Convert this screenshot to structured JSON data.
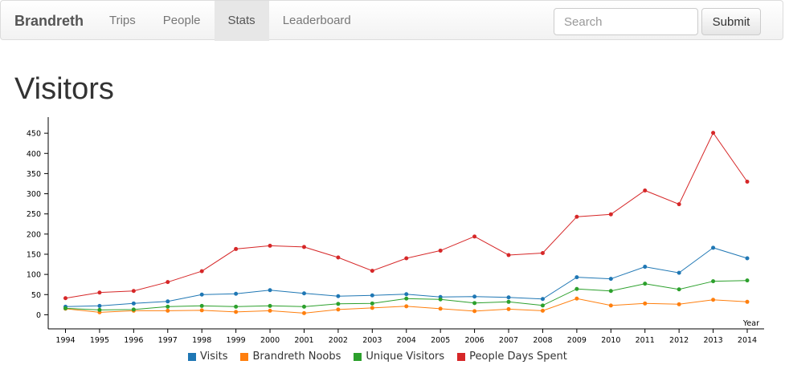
{
  "navbar": {
    "brand": "Brandreth",
    "items": [
      {
        "label": "Trips",
        "active": false
      },
      {
        "label": "People",
        "active": false
      },
      {
        "label": "Stats",
        "active": true
      },
      {
        "label": "Leaderboard",
        "active": false
      }
    ],
    "search_placeholder": "Search",
    "submit_label": "Submit"
  },
  "page": {
    "title": "Visitors"
  },
  "chart_data": {
    "type": "line",
    "title": "",
    "xlabel": "Year",
    "ylabel": "",
    "ylim": [
      -35,
      490
    ],
    "yticks": [
      0,
      50,
      100,
      150,
      200,
      250,
      300,
      350,
      400,
      450
    ],
    "categories": [
      "1994",
      "1995",
      "1996",
      "1997",
      "1998",
      "1999",
      "2000",
      "2001",
      "2002",
      "2003",
      "2004",
      "2005",
      "2006",
      "2007",
      "2008",
      "2009",
      "2010",
      "2011",
      "2012",
      "2013",
      "2014"
    ],
    "legend_position": "bottom",
    "series": [
      {
        "name": "Visits",
        "color": "#1f77b4",
        "values": [
          20,
          22,
          28,
          33,
          50,
          52,
          61,
          53,
          46,
          48,
          51,
          44,
          45,
          43,
          39,
          93,
          89,
          119,
          104,
          166,
          140
        ]
      },
      {
        "name": "Brandreth Noobs",
        "color": "#ff7f0e",
        "values": [
          15,
          6,
          10,
          10,
          11,
          7,
          10,
          4,
          13,
          17,
          21,
          15,
          9,
          14,
          10,
          40,
          23,
          28,
          26,
          37,
          32
        ]
      },
      {
        "name": "Unique Visitors",
        "color": "#2ca02c",
        "values": [
          16,
          12,
          13,
          20,
          22,
          20,
          22,
          20,
          27,
          28,
          40,
          38,
          29,
          32,
          23,
          64,
          59,
          77,
          63,
          83,
          85
        ]
      },
      {
        "name": "People Days Spent",
        "color": "#d62728",
        "values": [
          41,
          55,
          59,
          81,
          108,
          163,
          171,
          168,
          142,
          109,
          140,
          159,
          194,
          148,
          153,
          243,
          249,
          308,
          274,
          451,
          330
        ]
      }
    ]
  }
}
